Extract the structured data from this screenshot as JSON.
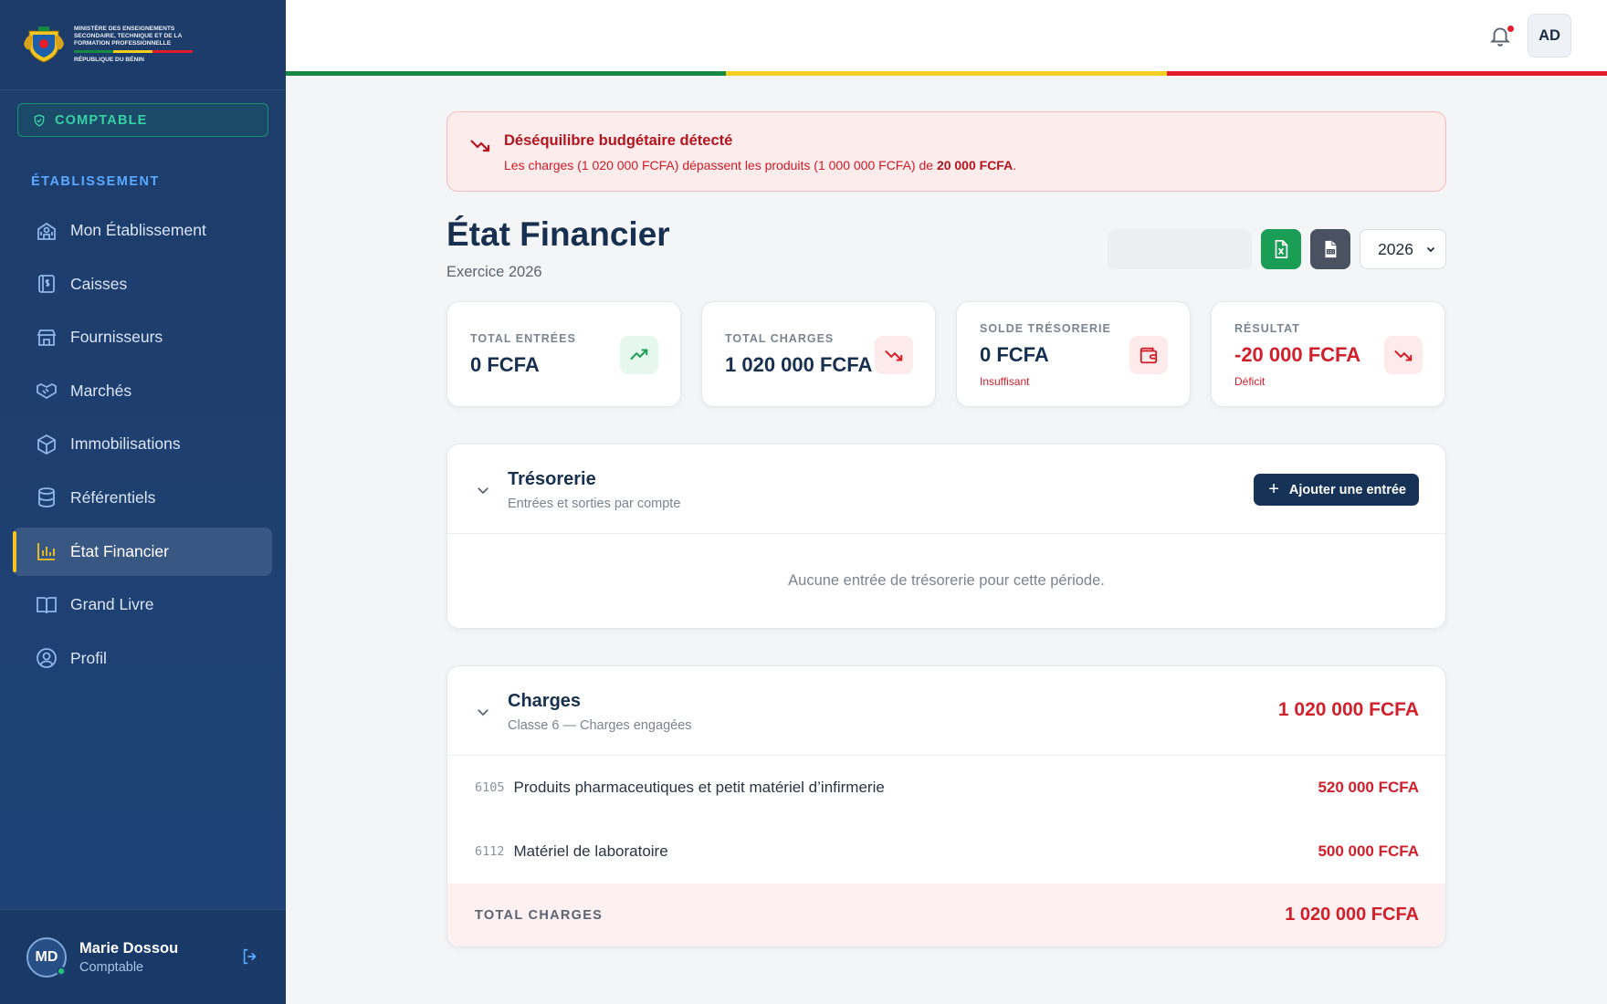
{
  "brand": {
    "ministry_lines": [
      "Ministère des Enseignements",
      "Secondaire, Technique et de la",
      "Formation Professionnelle"
    ],
    "country": "République du Bénin"
  },
  "role_badge": "COMPTABLE",
  "sidebar": {
    "section": "ÉTABLISSEMENT",
    "items": [
      {
        "label": "Mon Établissement",
        "icon": "school-icon",
        "active": false
      },
      {
        "label": "Caisses",
        "icon": "cash-register-icon",
        "active": false
      },
      {
        "label": "Fournisseurs",
        "icon": "store-icon",
        "active": false
      },
      {
        "label": "Marchés",
        "icon": "handshake-icon",
        "active": false
      },
      {
        "label": "Immobilisations",
        "icon": "box-icon",
        "active": false
      },
      {
        "label": "Référentiels",
        "icon": "database-icon",
        "active": false
      },
      {
        "label": "État Financier",
        "icon": "bar-chart-icon",
        "active": true
      },
      {
        "label": "Grand Livre",
        "icon": "book-icon",
        "active": false
      },
      {
        "label": "Profil",
        "icon": "user-circle-icon",
        "active": false
      }
    ]
  },
  "user": {
    "initials": "MD",
    "name": "Marie Dossou",
    "role": "Comptable"
  },
  "topbar": {
    "avatar_initials": "AD"
  },
  "colors": {
    "flag_green": "#168a45",
    "flag_yellow": "#f3d020",
    "flag_red": "#e21c2c",
    "accent_red": "#d1202b",
    "navy": "#163357"
  },
  "alert": {
    "title": "Déséquilibre budgétaire détecté",
    "message_prefix": "Les charges (1 020 000 FCFA) dépassent les produits (1 000 000 FCFA) de ",
    "message_amount": "20 000 FCFA",
    "message_suffix": "."
  },
  "page": {
    "title": "État Financier",
    "subtitle": "Exercice 2026",
    "year": "2026"
  },
  "stats": [
    {
      "label": "TOTAL ENTRÉES",
      "value": "0 FCFA",
      "note": ""
    },
    {
      "label": "TOTAL CHARGES",
      "value": "1 020 000 FCFA",
      "note": ""
    },
    {
      "label": "SOLDE TRÉSORERIE",
      "value": "0 FCFA",
      "note": "Insuffisant"
    },
    {
      "label": "RÉSULTAT",
      "value": "-20 000 FCFA",
      "note": "Déficit"
    }
  ],
  "tresorerie": {
    "title": "Trésorerie",
    "subtitle": "Entrées et sorties par compte",
    "add_label": "Ajouter une entrée",
    "empty": "Aucune entrée de trésorerie pour cette période."
  },
  "charges": {
    "title": "Charges",
    "subtitle": "Classe 6 — Charges engagées",
    "total": "1 020 000 FCFA",
    "rows": [
      {
        "code": "6105",
        "label": "Produits pharmaceutiques et petit matériel d’infirmerie",
        "amount": "520 000 FCFA"
      },
      {
        "code": "6112",
        "label": "Matériel de laboratoire",
        "amount": "500 000 FCFA"
      }
    ],
    "total_label": "TOTAL CHARGES",
    "total_amount": "1 020 000 FCFA"
  }
}
